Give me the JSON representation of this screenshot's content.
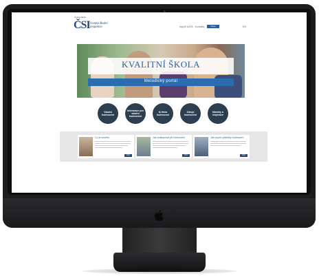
{
  "header": {
    "logo_small": "Česká školní",
    "logo_abbr": "ČSI",
    "logo_line1": "Česká školní",
    "logo_line2": "inspekce",
    "link_text": "InspIS DATA · Kontakty",
    "button_label": "Vstup",
    "lang": "EN"
  },
  "hero": {
    "title": "KVALITNÍ ŠKOLA",
    "subtitle": "Metodický portál"
  },
  "circles": [
    {
      "label": "Vlastní hodnocení"
    },
    {
      "label": "Informace pro vlastní hodnocení"
    },
    {
      "label": "Kritéria hodnocení"
    },
    {
      "label": "Zdroje hodnocení"
    },
    {
      "label": "Náměty a inspirace"
    }
  ],
  "cards": [
    {
      "title": "Co je nového",
      "button": "Více"
    },
    {
      "title": "Jak postupovat při hodnocení",
      "button": "Více"
    },
    {
      "title": "Jak využít výsledky hodnocení",
      "button": "Více"
    }
  ],
  "colors": {
    "brand": "#2b4a73",
    "accent": "#2b6cb0",
    "circle": "#2c3e50"
  }
}
